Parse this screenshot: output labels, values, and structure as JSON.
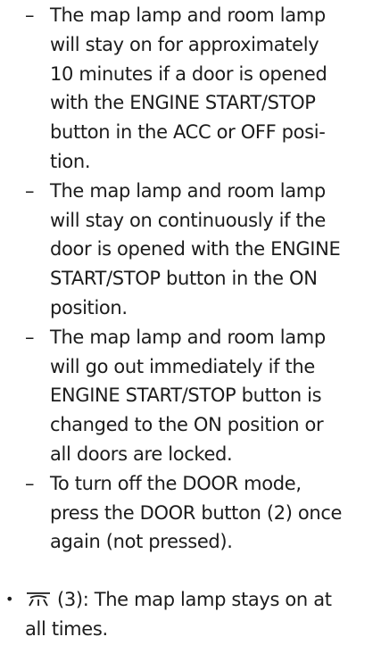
{
  "sub_items": [
    {
      "marker": "–",
      "lines": [
        "The map lamp and room lamp",
        "will stay on for approximately",
        "10 minutes if a door is opened",
        "with the ENGINE START/STOP",
        "button in the ACC or OFF posi-",
        "tion."
      ]
    },
    {
      "marker": "–",
      "lines": [
        "The map lamp and room lamp",
        "will stay on continuously if the",
        "door is opened with the ENGINE",
        "START/STOP button in the ON",
        "position."
      ]
    },
    {
      "marker": "–",
      "lines": [
        "The map lamp and room lamp",
        "will go out immediately if the",
        "ENGINE START/STOP button is",
        "changed to the ON position or",
        "all doors are locked."
      ]
    },
    {
      "marker": "–",
      "lines": [
        "To turn off the DOOR mode,",
        "press the DOOR button (2) once",
        "again (not pressed)."
      ]
    }
  ],
  "bullet": {
    "marker": "•",
    "icon": "map-lamp-icon",
    "line1": "(3): The map lamp stays on at",
    "line2": "all times."
  }
}
